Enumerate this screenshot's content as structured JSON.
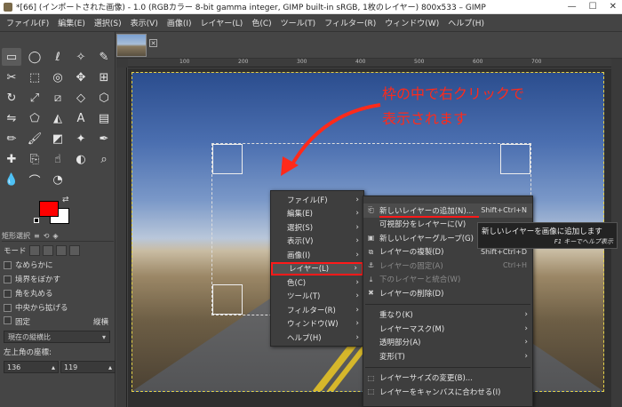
{
  "window": {
    "title": "*[66] (インポートされた画像) - 1.0 (RGBカラー 8-bit gamma integer, GIMP built-in sRGB, 1枚のレイヤー) 800x533 – GIMP",
    "minimize": "—",
    "maximize": "☐",
    "close": "✕"
  },
  "menubar": [
    "ファイル(F)",
    "編集(E)",
    "選択(S)",
    "表示(V)",
    "画像(I)",
    "レイヤー(L)",
    "色(C)",
    "ツール(T)",
    "フィルター(R)",
    "ウィンドウ(W)",
    "ヘルプ(H)"
  ],
  "toolbox": {
    "tools": [
      {
        "name": "rect-select-icon",
        "glyph": "▭"
      },
      {
        "name": "ellipse-select-icon",
        "glyph": "◯"
      },
      {
        "name": "free-select-icon",
        "glyph": "ℓ"
      },
      {
        "name": "fuzzy-select-icon",
        "glyph": "✧"
      },
      {
        "name": "color-picker-icon",
        "glyph": "✎"
      },
      {
        "name": "crop-icon",
        "glyph": "✂"
      },
      {
        "name": "unified-transform-icon",
        "glyph": "⬚"
      },
      {
        "name": "warp-transform-icon",
        "glyph": "◎"
      },
      {
        "name": "move-icon",
        "glyph": "✥"
      },
      {
        "name": "align-icon",
        "glyph": "⊞"
      },
      {
        "name": "rotate-icon",
        "glyph": "↻"
      },
      {
        "name": "scale-icon",
        "glyph": "⤢"
      },
      {
        "name": "shear-icon",
        "glyph": "⧄"
      },
      {
        "name": "perspective-icon",
        "glyph": "◇"
      },
      {
        "name": "3d-transform-icon",
        "glyph": "⬡"
      },
      {
        "name": "flip-icon",
        "glyph": "⇋"
      },
      {
        "name": "cage-icon",
        "glyph": "⬠"
      },
      {
        "name": "bucket-fill-icon",
        "glyph": "◭"
      },
      {
        "name": "text-icon",
        "glyph": "A"
      },
      {
        "name": "gradient-icon",
        "glyph": "▤"
      },
      {
        "name": "pencil-icon",
        "glyph": "✏"
      },
      {
        "name": "paintbrush-icon",
        "glyph": "🖌"
      },
      {
        "name": "eraser-icon",
        "glyph": "◩"
      },
      {
        "name": "airbrush-icon",
        "glyph": "✦"
      },
      {
        "name": "ink-icon",
        "glyph": "✒"
      },
      {
        "name": "heal-icon",
        "glyph": "✚"
      },
      {
        "name": "clone-icon",
        "glyph": "⎘"
      },
      {
        "name": "smudge-icon",
        "glyph": "☝"
      },
      {
        "name": "dodge-icon",
        "glyph": "◐"
      },
      {
        "name": "zoom-icon",
        "glyph": "⌕"
      },
      {
        "name": "blur-icon",
        "glyph": "💧"
      },
      {
        "name": "paths-icon",
        "glyph": "⌒"
      },
      {
        "name": "measure-icon",
        "glyph": "◔"
      }
    ],
    "panel_tabs": [
      "矩形選択",
      "≡",
      "⟲",
      "◈"
    ],
    "panel_title": "矩形選択",
    "mode_label": "モード",
    "options": {
      "antialias": "なめらかに",
      "feather": "境界をぼかす",
      "rounded": "角を丸める",
      "expand_center": "中央から拡げる",
      "fixed_label": "固定",
      "fixed_right": "縦横",
      "fixed_value": "現在の縦横比",
      "position_label": "左上角の座標:",
      "pos_x": "136",
      "pos_y": "119"
    }
  },
  "ruler_labels": [
    "100",
    "200",
    "300",
    "400",
    "500",
    "600",
    "700"
  ],
  "annotation": {
    "line1": "枠の中で右クリックで",
    "line2": "表示されます",
    "color": "#ff2a1a"
  },
  "context_menu": {
    "items": [
      "ファイル(F)",
      "編集(E)",
      "選択(S)",
      "表示(V)",
      "画像(I)",
      "レイヤー(L)",
      "色(C)",
      "ツール(T)",
      "フィルター(R)",
      "ウィンドウ(W)",
      "ヘルプ(H)"
    ],
    "highlighted": "レイヤー(L)"
  },
  "layer_submenu": {
    "items": [
      {
        "label": "新しいレイヤーの追加(N)...",
        "shortcut": "Shift+Ctrl+N",
        "icon": "⎗"
      },
      {
        "label": "可視部分をレイヤーに(V)",
        "shortcut": "",
        "icon": ""
      },
      {
        "label": "新しいレイヤーグループ(G)",
        "shortcut": "",
        "icon": "▣"
      },
      {
        "label": "レイヤーの複製(D)",
        "shortcut": "Shift+Ctrl+D",
        "icon": "⧉"
      },
      {
        "label": "レイヤーの固定(A)",
        "shortcut": "Ctrl+H",
        "icon": "⚓"
      },
      {
        "label": "下のレイヤーと統合(W)",
        "shortcut": "",
        "icon": "⤓"
      },
      {
        "label": "レイヤーの削除(D)",
        "shortcut": "",
        "icon": "✖"
      },
      {
        "label": "重なり(K)",
        "shortcut": "",
        "icon": ""
      },
      {
        "label": "レイヤーマスク(M)",
        "shortcut": "",
        "icon": ""
      },
      {
        "label": "透明部分(A)",
        "shortcut": "",
        "icon": ""
      },
      {
        "label": "変形(T)",
        "shortcut": "",
        "icon": ""
      },
      {
        "label": "レイヤーサイズの変更(B)...",
        "shortcut": "",
        "icon": "⬚"
      },
      {
        "label": "レイヤーをキャンバスに合わせる(I)",
        "shortcut": "",
        "icon": "⬚"
      }
    ]
  },
  "tooltip": {
    "text": "新しいレイヤーを画像に追加します",
    "help": "F1 キーでヘルプ表示"
  }
}
